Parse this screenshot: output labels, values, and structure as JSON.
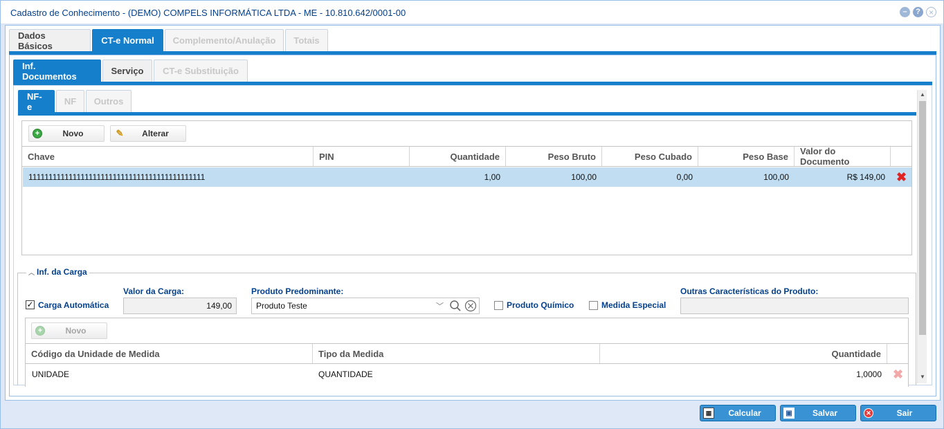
{
  "window": {
    "title": "Cadastro de Conhecimento - (DEMO) COMPELS INFORMÁTICA LTDA - ME - 10.810.642/0001-00"
  },
  "tabs_main": [
    {
      "label": "Dados Básicos",
      "state": "normal"
    },
    {
      "label": "CT-e Normal",
      "state": "active"
    },
    {
      "label": "Complemento/Anulação",
      "state": "disabled"
    },
    {
      "label": "Totais",
      "state": "disabled"
    }
  ],
  "tabs_sub": [
    {
      "label": "Inf. Documentos",
      "state": "active"
    },
    {
      "label": "Serviço",
      "state": "normal"
    },
    {
      "label": "CT-e Substituição",
      "state": "disabled"
    }
  ],
  "tabs_doc": [
    {
      "label": "NF-e",
      "state": "active"
    },
    {
      "label": "NF",
      "state": "disabled"
    },
    {
      "label": "Outros",
      "state": "disabled"
    }
  ],
  "nfe_toolbar": {
    "new_label": "Novo",
    "edit_label": "Alterar"
  },
  "nfe_grid": {
    "columns": [
      "Chave",
      "PIN",
      "Quantidade",
      "Peso Bruto",
      "Peso Cubado",
      "Peso Base",
      "Valor do Documento"
    ],
    "rows": [
      {
        "chave": "11111111111111111111111111111111111111111111",
        "pin": "",
        "quantidade": "1,00",
        "peso_bruto": "100,00",
        "peso_cubado": "0,00",
        "peso_base": "100,00",
        "valor": "R$ 149,00"
      }
    ]
  },
  "carga": {
    "legend": "Inf. da Carga",
    "auto_label": "Carga Automática",
    "auto_checked": "✓",
    "valor_label": "Valor da Carga:",
    "valor_value": "149,00",
    "produto_label": "Produto Predominante:",
    "produto_value": "Produto Teste",
    "quimico_label": "Produto Químico",
    "especial_label": "Medida Especial",
    "outras_label": "Outras Características do Produto:",
    "outras_value": ""
  },
  "medida_toolbar": {
    "new_label": "Novo"
  },
  "medida_grid": {
    "columns": [
      "Código da Unidade de Medida",
      "Tipo da Medida",
      "Quantidade"
    ],
    "rows": [
      {
        "codigo": "UNIDADE",
        "tipo": "QUANTIDADE",
        "quantidade": "1,0000"
      }
    ]
  },
  "actions": {
    "calc_label": "Calcular",
    "save_label": "Salvar",
    "exit_label": "Sair"
  },
  "icons": {
    "minimize": "minimize-icon",
    "help": "help-icon",
    "close": "close-icon"
  },
  "colors": {
    "accent": "#157fcc",
    "title_text": "#04408c",
    "selected_row": "#c1ddf1",
    "delete_icon": "#e32222"
  }
}
